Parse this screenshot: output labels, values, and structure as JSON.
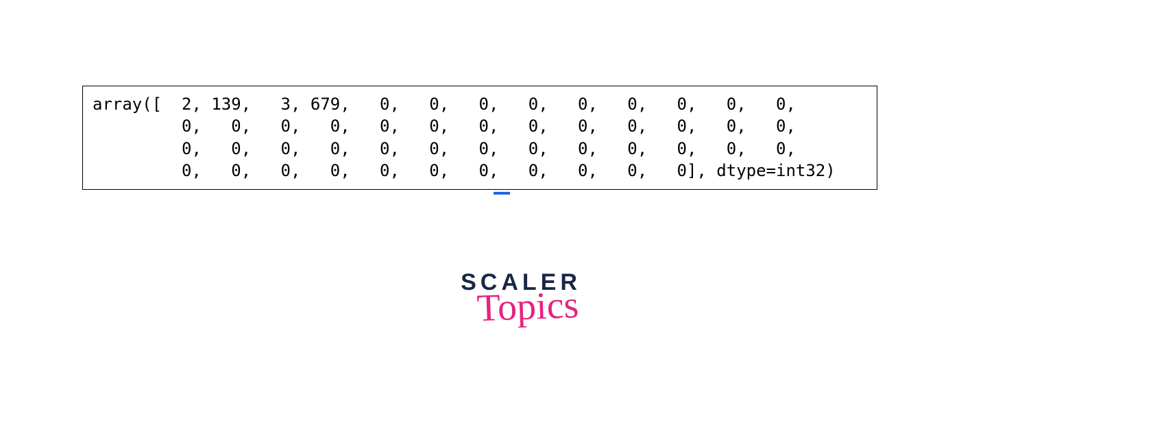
{
  "code_output": {
    "line1": "array([  2, 139,   3, 679,   0,   0,   0,   0,   0,   0,   0,   0,   0,",
    "line2": "         0,   0,   0,   0,   0,   0,   0,   0,   0,   0,   0,   0,   0,",
    "line3": "         0,   0,   0,   0,   0,   0,   0,   0,   0,   0,   0,   0,   0,",
    "line4": "         0,   0,   0,   0,   0,   0,   0,   0,   0,   0,   0], dtype=int32)"
  },
  "logo": {
    "line1": "SCALER",
    "line2": "Topics"
  }
}
